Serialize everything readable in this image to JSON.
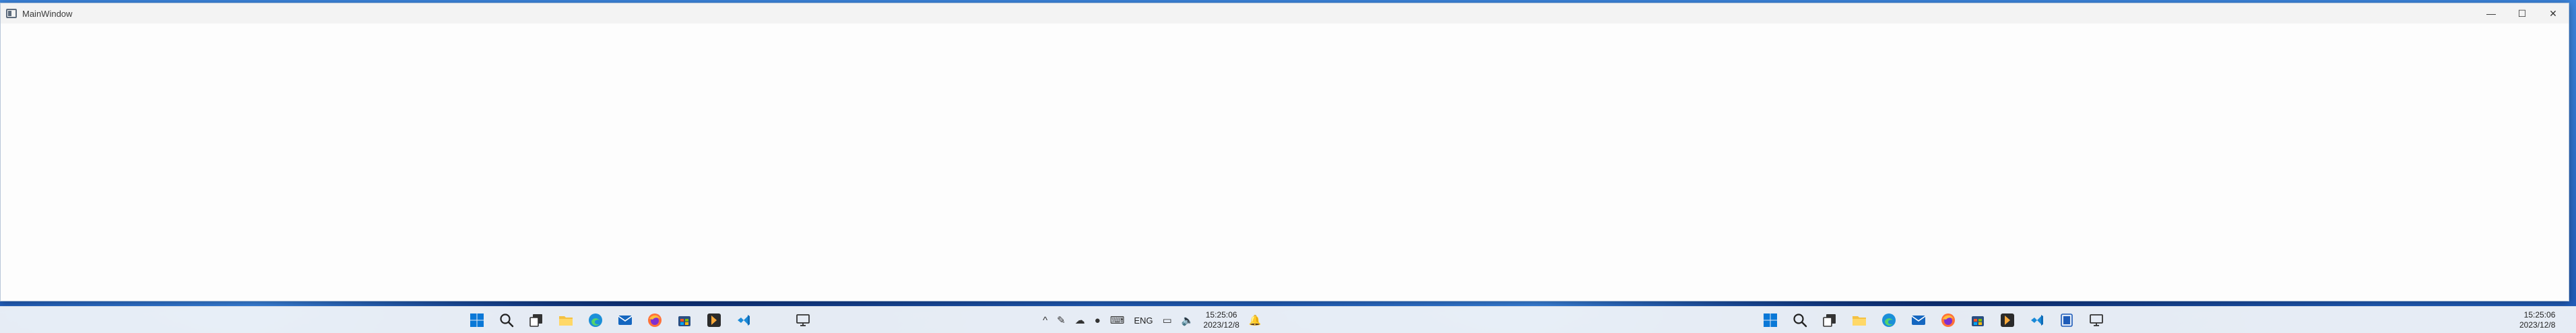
{
  "window": {
    "title": "MainWindow",
    "minimize_glyph": "—",
    "maximize_glyph": "☐",
    "close_glyph": "✕"
  },
  "taskbar_left": {
    "icons": [
      "start-icon",
      "search-icon",
      "task-view-icon",
      "file-explorer-icon",
      "edge-icon",
      "mail-icon",
      "firefox-icon",
      "store-icon",
      "app-icon",
      "vscode-icon",
      "desktop-icon"
    ],
    "tray": {
      "chevron": "^",
      "language": "ENG",
      "time": "15:25:06",
      "date": "2023/12/8"
    }
  },
  "taskbar_right": {
    "icons": [
      "start-icon",
      "search-icon",
      "task-view-icon",
      "file-explorer-icon",
      "edge-icon",
      "mail-icon",
      "firefox-icon",
      "store-icon",
      "app-icon",
      "vscode-icon",
      "window-icon",
      "desktop-icon"
    ],
    "tray": {
      "time": "15:25:06",
      "date": "2023/12/8"
    }
  },
  "colors": {
    "taskbar": "#eef2f8",
    "window_bg": "#ffffff",
    "accent": "#0078d4"
  }
}
